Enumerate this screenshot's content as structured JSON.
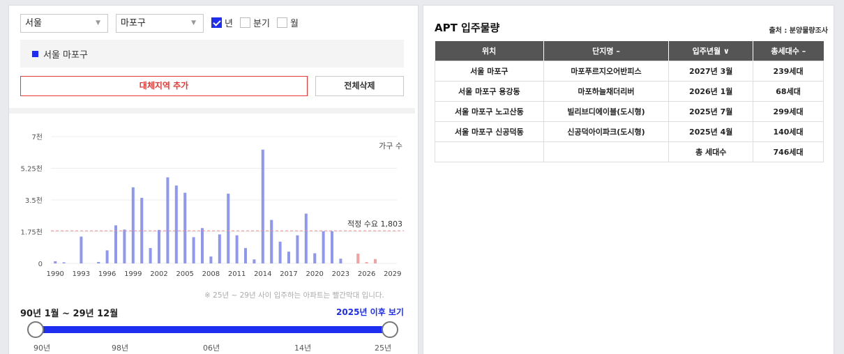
{
  "filters": {
    "region": "서울",
    "district": "마포구",
    "period_options": [
      {
        "label": "년",
        "checked": true
      },
      {
        "label": "분기",
        "checked": false
      },
      {
        "label": "월",
        "checked": false
      }
    ]
  },
  "selected_region": "서울 마포구",
  "buttons": {
    "add_region": "대체지역 추가",
    "clear_all": "전체삭제"
  },
  "chart_note": "※ 25년 ~ 29년 사이 입주하는 아파트는 빨간막대 입니다.",
  "period_label": "90년 1월 ~ 29년 12월",
  "after_link": "2025년 이후 보기",
  "slider_ticks": [
    "90년",
    "98년",
    "06년",
    "14년",
    "25년"
  ],
  "slider": {
    "start": "90년",
    "end": "25년"
  },
  "table": {
    "title": "APT 입주물량",
    "source": "출처 : 분양물량조사",
    "headers": [
      "위치",
      "단지명 –",
      "입주년월 ∨",
      "총세대수 –"
    ],
    "rows": [
      [
        "서울 마포구",
        "마포푸르지오어반피스",
        "2027년 3월",
        "239세대"
      ],
      [
        "서울 마포구 용강동",
        "마포하늘채더리버",
        "2026년 1월",
        "68세대"
      ],
      [
        "서울 마포구 노고산동",
        "빌리브디에이블(도시형)",
        "2025년 7월",
        "299세대"
      ],
      [
        "서울 마포구 신공덕동",
        "신공덕아이파크(도시형)",
        "2025년 4월",
        "140세대"
      ]
    ],
    "total_label": "총 세대수",
    "total_value": "746세대"
  },
  "chart_data": {
    "type": "bar",
    "series_label": "가구 수",
    "ylim": [
      0,
      7000
    ],
    "y_ticks": [
      0,
      1750,
      3500,
      5250,
      7000
    ],
    "y_tick_labels": [
      "0",
      "1.75천",
      "3.5천",
      "5.25천",
      "7천"
    ],
    "x_tick_labels": [
      "1990",
      "1993",
      "1996",
      "1999",
      "2002",
      "2005",
      "2008",
      "2011",
      "2014",
      "2017",
      "2020",
      "2023",
      "2026",
      "2029"
    ],
    "reference_line": {
      "label": "적정 수요 1,803",
      "value": 1803
    },
    "colors": {
      "past": "#8e98f2",
      "future": "#f4a1a1",
      "reference": "#f08a8a"
    },
    "years": [
      1990,
      1991,
      1992,
      1993,
      1994,
      1995,
      1996,
      1997,
      1998,
      1999,
      2000,
      2001,
      2002,
      2003,
      2004,
      2005,
      2006,
      2007,
      2008,
      2009,
      2010,
      2011,
      2012,
      2013,
      2014,
      2015,
      2016,
      2017,
      2018,
      2019,
      2020,
      2021,
      2022,
      2023,
      2024,
      2025,
      2026,
      2027,
      2028,
      2029
    ],
    "values": [
      120,
      60,
      0,
      1480,
      0,
      80,
      720,
      2100,
      1870,
      4200,
      3620,
      850,
      1850,
      4750,
      4300,
      3900,
      1450,
      1950,
      380,
      1600,
      3850,
      1550,
      850,
      220,
      6280,
      2400,
      1200,
      650,
      1550,
      2750,
      560,
      1780,
      1780,
      260,
      0,
      540,
      70,
      240,
      0,
      0
    ]
  }
}
